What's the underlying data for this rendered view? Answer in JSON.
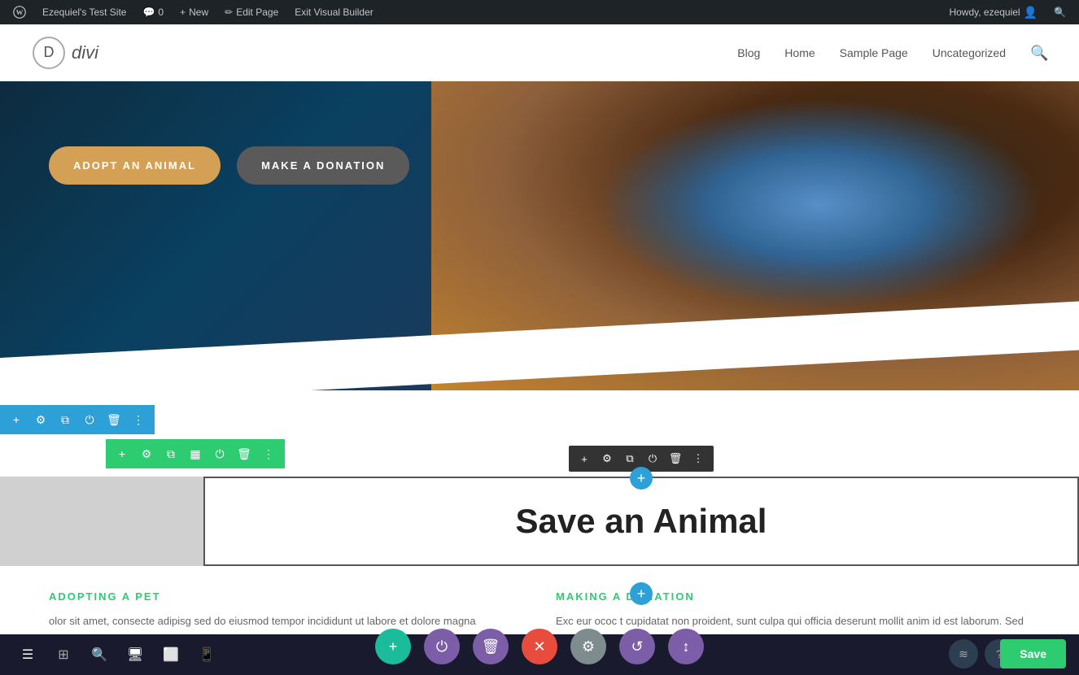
{
  "adminBar": {
    "wpIcon": "W",
    "siteName": "Ezequiel's Test Site",
    "comments": "0",
    "newLabel": "New",
    "editPageLabel": "Edit Page",
    "exitBuilderLabel": "Exit Visual Builder",
    "howdy": "Howdy, ezequiel"
  },
  "siteHeader": {
    "logoLetter": "D",
    "logoName": "divi",
    "navLinks": [
      "Blog",
      "Home",
      "Sample Page",
      "Uncategorized"
    ]
  },
  "hero": {
    "adoptBtn": "ADOPT AN ANIMAL",
    "donateBtn": "MAKE A DONATION"
  },
  "moduleToolbar": {
    "icons": [
      "+",
      "⚙",
      "⧉",
      "⏻",
      "🗑",
      "⋮"
    ]
  },
  "rowToolbar": {
    "icons": [
      "+",
      "⚙",
      "⧉",
      "⏻",
      "🗑",
      "⋮"
    ]
  },
  "colToolbar": {
    "icons": [
      "+",
      "⚙",
      "⧉",
      "▦",
      "⏻",
      "🗑",
      "⋮"
    ]
  },
  "moduleTitle": "Save an Animal",
  "contentSection": {
    "col1": {
      "heading": "ADOPTING A PET",
      "text": "olor sit amet, consecte  adipisg  sed do eiusmod tempor incididunt ut labore et dolore magna"
    },
    "col2": {
      "heading": "MAKING A DONATION",
      "text": "Exc eur  ococ t cupidatat non proident, sunt culpa qui officia deserunt mollit anim id est laborum. Sed ut"
    }
  },
  "bottomToolbar": {
    "icons": [
      "≡",
      "⊞",
      "🔍",
      "🖥",
      "⬜",
      "📱"
    ],
    "fabIcons": [
      "+",
      "⏻",
      "🗑",
      "✕",
      "⚙",
      "↺",
      "↕"
    ],
    "fabColors": [
      "teal",
      "purple",
      "purple",
      "red",
      "gray",
      "purple",
      "purple"
    ],
    "rightFabIcons": [
      "≋",
      "?"
    ],
    "saveLabel": "Save"
  }
}
